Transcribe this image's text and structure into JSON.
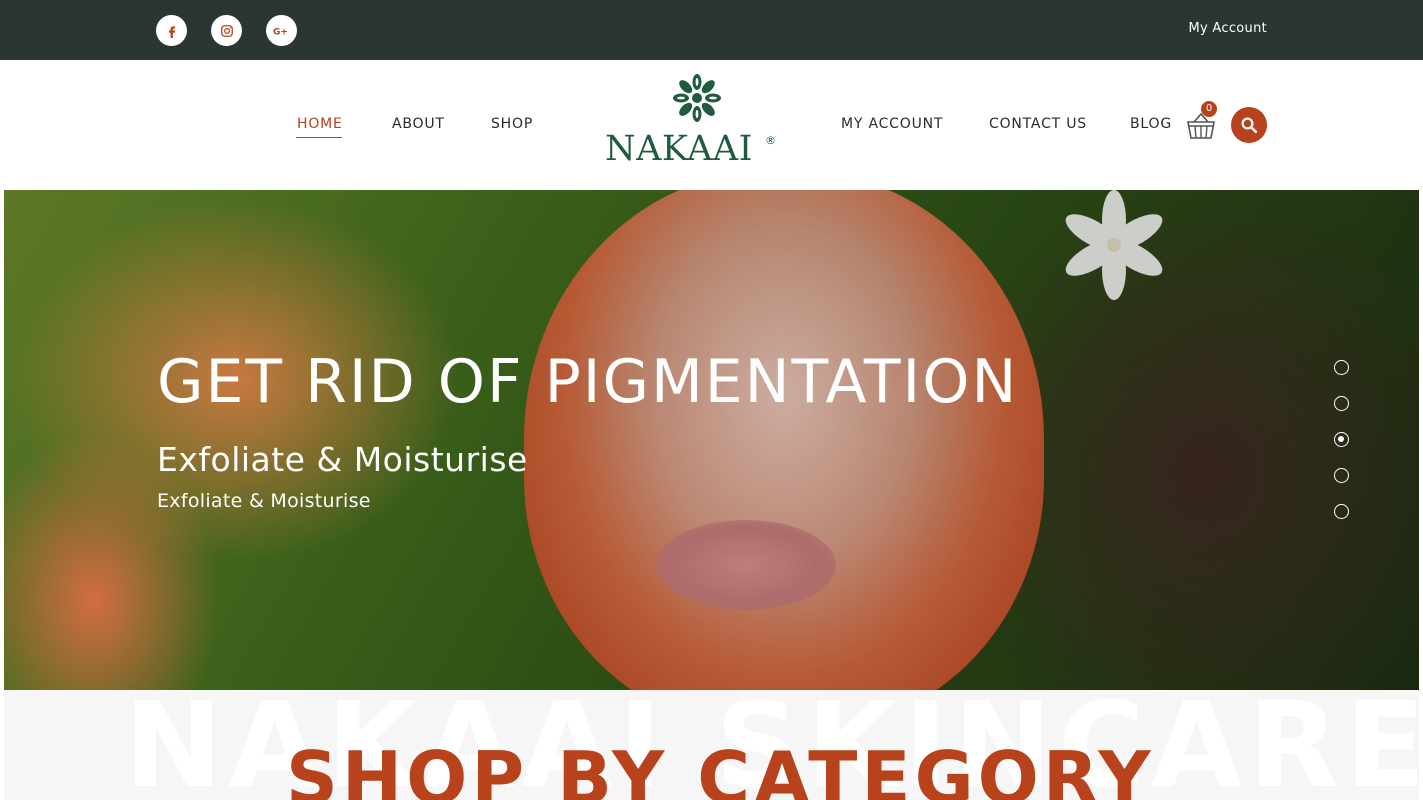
{
  "topbar": {
    "social": [
      {
        "name": "facebook-icon"
      },
      {
        "name": "instagram-icon"
      },
      {
        "name": "google-plus-icon"
      }
    ],
    "account_label": "My Account"
  },
  "header": {
    "nav_left": [
      "HOME",
      "ABOUT",
      "SHOP"
    ],
    "nav_right": [
      "MY ACCOUNT",
      "CONTACT US",
      "BLOG"
    ],
    "active": "HOME",
    "logo_text": "NAKAAI",
    "logo_reg": "®",
    "cart_count": "0"
  },
  "hero": {
    "title": "GET RID OF PIGMENTATION",
    "subtitle": "Exfoliate & Moisturise",
    "caption": "Exfoliate & Moisturise",
    "slides_total": 5,
    "active_slide": 3
  },
  "category": {
    "watermark": "NAKAAI SKINCARE",
    "title": "SHOP BY CATEGORY"
  },
  "colors": {
    "accent": "#b8421b",
    "topbar": "#2b3632",
    "logo_green": "#1f5c3b"
  }
}
